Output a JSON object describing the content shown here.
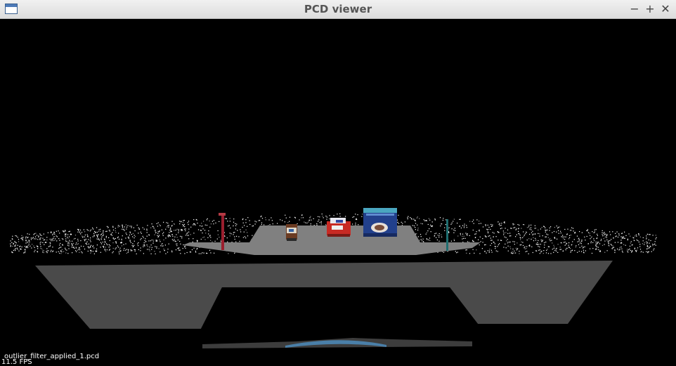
{
  "window": {
    "title": "PCD viewer",
    "buttons": {
      "minimize": "−",
      "maximize": "+",
      "close": "✕"
    }
  },
  "viewer": {
    "background": "#000000",
    "file_label": "outlier_filter_applied_1.pcd",
    "fps_label": "11.5 FPS",
    "icons": [
      "window-app-icon",
      "minimize-icon",
      "maximize-icon",
      "close-icon"
    ],
    "colors": {
      "table_top": "#808080",
      "table_body": "#4a4a4a",
      "floor_blue": "#4a7fa8",
      "noise_points": "#ffffff"
    }
  }
}
